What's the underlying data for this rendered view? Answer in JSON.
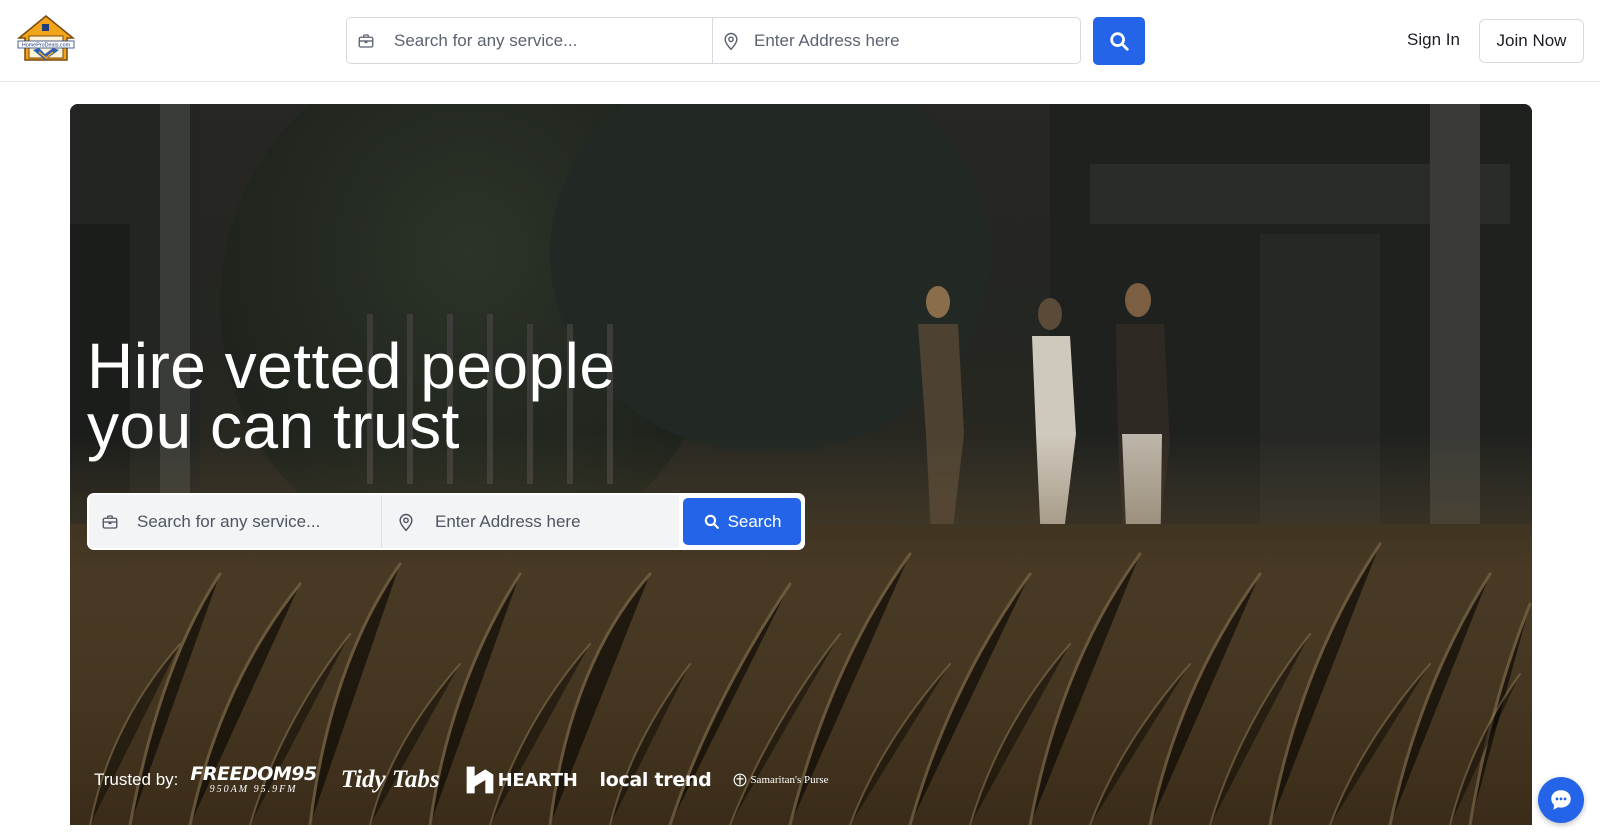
{
  "header": {
    "logo_text": "HomeProDeals.com",
    "search": {
      "service_placeholder": "Search for any service...",
      "address_placeholder": "Enter Address here"
    },
    "sign_in_label": "Sign In",
    "join_now_label": "Join Now"
  },
  "hero": {
    "headline_line1": "Hire vetted people",
    "headline_line2": "you can trust",
    "search": {
      "service_placeholder": "Search for any service...",
      "address_placeholder": "Enter Address here",
      "button_label": "Search"
    },
    "trusted": {
      "label": "Trusted by:",
      "brands": [
        {
          "name": "FREEDOM95",
          "sub": "950AM 95.9FM"
        },
        {
          "name": "Tidy Tabs"
        },
        {
          "name": "HEARTH"
        },
        {
          "name": "local trend"
        },
        {
          "name": "Samaritan's Purse"
        }
      ]
    }
  },
  "colors": {
    "accent": "#2364e8",
    "border": "#d6d9de",
    "hero_dark": "#2b2a22"
  },
  "icons": {
    "service": "briefcase-icon",
    "address": "map-pin-icon",
    "search": "search-icon",
    "chat": "chat-icon"
  }
}
